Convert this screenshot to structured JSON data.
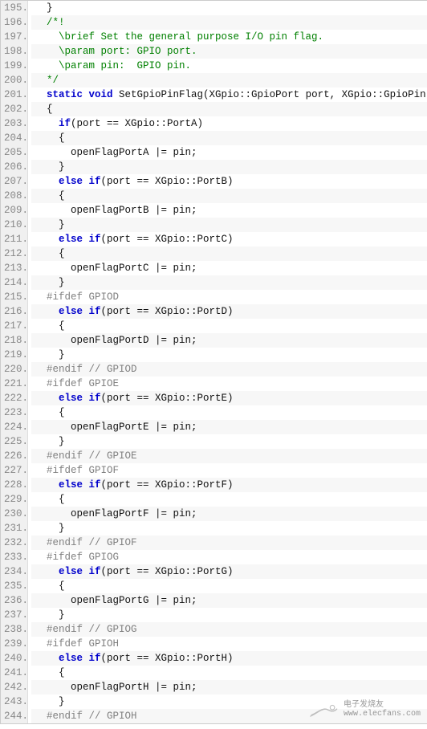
{
  "lines": [
    {
      "num": "195.",
      "tokens": [
        {
          "t": "punc",
          "v": "  }"
        }
      ]
    },
    {
      "num": "196.",
      "tokens": [
        {
          "t": "doccomment",
          "v": "  /*!"
        }
      ]
    },
    {
      "num": "197.",
      "tokens": [
        {
          "t": "doccomment",
          "v": "    \\brief Set the general purpose I/O pin flag."
        }
      ]
    },
    {
      "num": "198.",
      "tokens": [
        {
          "t": "doccomment",
          "v": "    \\param port: GPIO port."
        }
      ]
    },
    {
      "num": "199.",
      "tokens": [
        {
          "t": "doccomment",
          "v": "    \\param pin:  GPIO pin."
        }
      ]
    },
    {
      "num": "200.",
      "tokens": [
        {
          "t": "doccomment",
          "v": "  */"
        }
      ]
    },
    {
      "num": "201.",
      "tokens": [
        {
          "t": "text",
          "v": "  "
        },
        {
          "t": "kw",
          "v": "static void"
        },
        {
          "t": "text",
          "v": " SetGpioPinFlag(XGpio::GpioPort port, XGpio::GpioPin pin)"
        }
      ]
    },
    {
      "num": "202.",
      "tokens": [
        {
          "t": "punc",
          "v": "  {"
        }
      ]
    },
    {
      "num": "203.",
      "tokens": [
        {
          "t": "text",
          "v": "    "
        },
        {
          "t": "kw",
          "v": "if"
        },
        {
          "t": "text",
          "v": "(port == XGpio::PortA)"
        }
      ]
    },
    {
      "num": "204.",
      "tokens": [
        {
          "t": "punc",
          "v": "    {"
        }
      ]
    },
    {
      "num": "205.",
      "tokens": [
        {
          "t": "text",
          "v": "      openFlagPortA |= pin;"
        }
      ]
    },
    {
      "num": "206.",
      "tokens": [
        {
          "t": "punc",
          "v": "    }"
        }
      ]
    },
    {
      "num": "207.",
      "tokens": [
        {
          "t": "text",
          "v": "    "
        },
        {
          "t": "kw",
          "v": "else if"
        },
        {
          "t": "text",
          "v": "(port == XGpio::PortB)"
        }
      ]
    },
    {
      "num": "208.",
      "tokens": [
        {
          "t": "punc",
          "v": "    {"
        }
      ]
    },
    {
      "num": "209.",
      "tokens": [
        {
          "t": "text",
          "v": "      openFlagPortB |= pin;"
        }
      ]
    },
    {
      "num": "210.",
      "tokens": [
        {
          "t": "punc",
          "v": "    }"
        }
      ]
    },
    {
      "num": "211.",
      "tokens": [
        {
          "t": "text",
          "v": "    "
        },
        {
          "t": "kw",
          "v": "else if"
        },
        {
          "t": "text",
          "v": "(port == XGpio::PortC)"
        }
      ]
    },
    {
      "num": "212.",
      "tokens": [
        {
          "t": "punc",
          "v": "    {"
        }
      ]
    },
    {
      "num": "213.",
      "tokens": [
        {
          "t": "text",
          "v": "      openFlagPortC |= pin;"
        }
      ]
    },
    {
      "num": "214.",
      "tokens": [
        {
          "t": "punc",
          "v": "    }"
        }
      ]
    },
    {
      "num": "215.",
      "tokens": [
        {
          "t": "pp",
          "v": "  #ifdef GPIOD"
        }
      ]
    },
    {
      "num": "216.",
      "tokens": [
        {
          "t": "text",
          "v": "    "
        },
        {
          "t": "kw",
          "v": "else if"
        },
        {
          "t": "text",
          "v": "(port == XGpio::PortD)"
        }
      ]
    },
    {
      "num": "217.",
      "tokens": [
        {
          "t": "punc",
          "v": "    {"
        }
      ]
    },
    {
      "num": "218.",
      "tokens": [
        {
          "t": "text",
          "v": "      openFlagPortD |= pin;"
        }
      ]
    },
    {
      "num": "219.",
      "tokens": [
        {
          "t": "punc",
          "v": "    }"
        }
      ]
    },
    {
      "num": "220.",
      "tokens": [
        {
          "t": "pp",
          "v": "  #endif"
        },
        {
          "t": "comment",
          "v": " // GPIOD"
        }
      ]
    },
    {
      "num": "221.",
      "tokens": [
        {
          "t": "pp",
          "v": "  #ifdef GPIOE"
        }
      ]
    },
    {
      "num": "222.",
      "tokens": [
        {
          "t": "text",
          "v": "    "
        },
        {
          "t": "kw",
          "v": "else if"
        },
        {
          "t": "text",
          "v": "(port == XGpio::PortE)"
        }
      ]
    },
    {
      "num": "223.",
      "tokens": [
        {
          "t": "punc",
          "v": "    {"
        }
      ]
    },
    {
      "num": "224.",
      "tokens": [
        {
          "t": "text",
          "v": "      openFlagPortE |= pin;"
        }
      ]
    },
    {
      "num": "225.",
      "tokens": [
        {
          "t": "punc",
          "v": "    }"
        }
      ]
    },
    {
      "num": "226.",
      "tokens": [
        {
          "t": "pp",
          "v": "  #endif"
        },
        {
          "t": "comment",
          "v": " // GPIOE"
        }
      ]
    },
    {
      "num": "227.",
      "tokens": [
        {
          "t": "pp",
          "v": "  #ifdef GPIOF"
        }
      ]
    },
    {
      "num": "228.",
      "tokens": [
        {
          "t": "text",
          "v": "    "
        },
        {
          "t": "kw",
          "v": "else if"
        },
        {
          "t": "text",
          "v": "(port == XGpio::PortF)"
        }
      ]
    },
    {
      "num": "229.",
      "tokens": [
        {
          "t": "punc",
          "v": "    {"
        }
      ]
    },
    {
      "num": "230.",
      "tokens": [
        {
          "t": "text",
          "v": "      openFlagPortF |= pin;"
        }
      ]
    },
    {
      "num": "231.",
      "tokens": [
        {
          "t": "punc",
          "v": "    }"
        }
      ]
    },
    {
      "num": "232.",
      "tokens": [
        {
          "t": "pp",
          "v": "  #endif"
        },
        {
          "t": "comment",
          "v": " // GPIOF"
        }
      ]
    },
    {
      "num": "233.",
      "tokens": [
        {
          "t": "pp",
          "v": "  #ifdef GPIOG"
        }
      ]
    },
    {
      "num": "234.",
      "tokens": [
        {
          "t": "text",
          "v": "    "
        },
        {
          "t": "kw",
          "v": "else if"
        },
        {
          "t": "text",
          "v": "(port == XGpio::PortG)"
        }
      ]
    },
    {
      "num": "235.",
      "tokens": [
        {
          "t": "punc",
          "v": "    {"
        }
      ]
    },
    {
      "num": "236.",
      "tokens": [
        {
          "t": "text",
          "v": "      openFlagPortG |= pin;"
        }
      ]
    },
    {
      "num": "237.",
      "tokens": [
        {
          "t": "punc",
          "v": "    }"
        }
      ]
    },
    {
      "num": "238.",
      "tokens": [
        {
          "t": "pp",
          "v": "  #endif"
        },
        {
          "t": "comment",
          "v": " // GPIOG"
        }
      ]
    },
    {
      "num": "239.",
      "tokens": [
        {
          "t": "pp",
          "v": "  #ifdef GPIOH"
        }
      ]
    },
    {
      "num": "240.",
      "tokens": [
        {
          "t": "text",
          "v": "    "
        },
        {
          "t": "kw",
          "v": "else if"
        },
        {
          "t": "text",
          "v": "(port == XGpio::PortH)"
        }
      ]
    },
    {
      "num": "241.",
      "tokens": [
        {
          "t": "punc",
          "v": "    {"
        }
      ]
    },
    {
      "num": "242.",
      "tokens": [
        {
          "t": "text",
          "v": "      openFlagPortH |= pin;"
        }
      ]
    },
    {
      "num": "243.",
      "tokens": [
        {
          "t": "punc",
          "v": "    }"
        }
      ]
    },
    {
      "num": "244.",
      "tokens": [
        {
          "t": "pp",
          "v": "  #endif"
        },
        {
          "t": "comment",
          "v": " // GPIOH"
        }
      ]
    }
  ],
  "watermark": {
    "brand": "电子发烧友",
    "url": "www.elecfans.com"
  }
}
